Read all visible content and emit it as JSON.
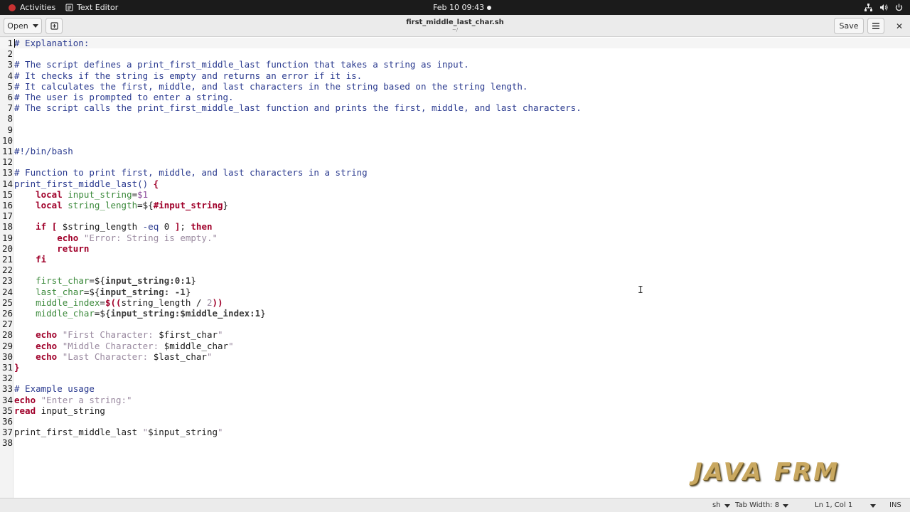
{
  "topbar": {
    "activities": "Activities",
    "app_name": "Text Editor",
    "clock": "Feb 10  09:43"
  },
  "header": {
    "open_label": "Open",
    "save_label": "Save",
    "title": "first_middle_last_char.sh",
    "subtitle": "~/"
  },
  "editor": {
    "lines": [
      [
        [
          "c-comment",
          "# Explanation:"
        ]
      ],
      [],
      [
        [
          "c-comment",
          "# The script defines a print_first_middle_last function that takes a string as input."
        ]
      ],
      [
        [
          "c-comment",
          "# It checks if the string is empty and returns an error if it is."
        ]
      ],
      [
        [
          "c-comment",
          "# It calculates the first, middle, and last characters in the string based on the string length."
        ]
      ],
      [
        [
          "c-comment",
          "# The user is prompted to enter a string."
        ]
      ],
      [
        [
          "c-comment",
          "# The script calls the print_first_middle_last function and prints the first, middle, and last characters."
        ]
      ],
      [],
      [],
      [],
      [
        [
          "c-comment",
          "#!/bin/bash"
        ]
      ],
      [],
      [
        [
          "c-comment",
          "# Function to print first, middle, and last characters in a string"
        ]
      ],
      [
        [
          "c-fn",
          "print_first_middle_last() "
        ],
        [
          "c-brace",
          "{"
        ]
      ],
      [
        [
          "c-plain",
          "    "
        ],
        [
          "c-kw",
          "local"
        ],
        [
          "c-plain",
          " "
        ],
        [
          "c-var",
          "input_string"
        ],
        [
          "c-plain",
          "="
        ],
        [
          "c-num",
          "$1"
        ]
      ],
      [
        [
          "c-plain",
          "    "
        ],
        [
          "c-kw",
          "local"
        ],
        [
          "c-plain",
          " "
        ],
        [
          "c-var",
          "string_length"
        ],
        [
          "c-plain",
          "=${"
        ],
        [
          "c-kw",
          "#input_string"
        ],
        [
          "c-plain",
          "}"
        ]
      ],
      [],
      [
        [
          "c-plain",
          "    "
        ],
        [
          "c-kw",
          "if"
        ],
        [
          "c-plain",
          " "
        ],
        [
          "c-kw",
          "["
        ],
        [
          "c-plain",
          " $string_length "
        ],
        [
          "c-fn",
          "-eq"
        ],
        [
          "c-plain",
          " 0 "
        ],
        [
          "c-kw",
          "]"
        ],
        [
          "c-plain",
          "; "
        ],
        [
          "c-kw",
          "then"
        ]
      ],
      [
        [
          "c-plain",
          "        "
        ],
        [
          "c-kw",
          "echo"
        ],
        [
          "c-plain",
          " "
        ],
        [
          "c-str",
          "\"Error: String is empty.\""
        ]
      ],
      [
        [
          "c-plain",
          "        "
        ],
        [
          "c-kw",
          "return"
        ]
      ],
      [
        [
          "c-plain",
          "    "
        ],
        [
          "c-kw",
          "fi"
        ]
      ],
      [],
      [
        [
          "c-plain",
          "    "
        ],
        [
          "c-var",
          "first_char"
        ],
        [
          "c-plain",
          "=${"
        ],
        [
          "c-sub",
          "input_string:0:1"
        ],
        [
          "c-plain",
          "}"
        ]
      ],
      [
        [
          "c-plain",
          "    "
        ],
        [
          "c-var",
          "last_char"
        ],
        [
          "c-plain",
          "=${"
        ],
        [
          "c-sub",
          "input_string: -1"
        ],
        [
          "c-plain",
          "}"
        ]
      ],
      [
        [
          "c-plain",
          "    "
        ],
        [
          "c-var",
          "middle_index"
        ],
        [
          "c-plain",
          "="
        ],
        [
          "c-kw",
          "$(("
        ],
        [
          "c-plain",
          "string_length / "
        ],
        [
          "c-str",
          "2"
        ],
        [
          "c-kw",
          "))"
        ]
      ],
      [
        [
          "c-plain",
          "    "
        ],
        [
          "c-var",
          "middle_char"
        ],
        [
          "c-plain",
          "=${"
        ],
        [
          "c-sub",
          "input_string:$middle_index:1"
        ],
        [
          "c-plain",
          "}"
        ]
      ],
      [],
      [
        [
          "c-plain",
          "    "
        ],
        [
          "c-kw",
          "echo"
        ],
        [
          "c-plain",
          " "
        ],
        [
          "c-str",
          "\"First Character: "
        ],
        [
          "c-plain",
          "$first_char"
        ],
        [
          "c-str",
          "\""
        ]
      ],
      [
        [
          "c-plain",
          "    "
        ],
        [
          "c-kw",
          "echo"
        ],
        [
          "c-plain",
          " "
        ],
        [
          "c-str",
          "\"Middle Character: "
        ],
        [
          "c-plain",
          "$middle_char"
        ],
        [
          "c-str",
          "\""
        ]
      ],
      [
        [
          "c-plain",
          "    "
        ],
        [
          "c-kw",
          "echo"
        ],
        [
          "c-plain",
          " "
        ],
        [
          "c-str",
          "\"Last Character: "
        ],
        [
          "c-plain",
          "$last_char"
        ],
        [
          "c-str",
          "\""
        ]
      ],
      [
        [
          "c-brace",
          "}"
        ]
      ],
      [],
      [
        [
          "c-comment",
          "# Example usage"
        ]
      ],
      [
        [
          "c-kw",
          "echo"
        ],
        [
          "c-plain",
          " "
        ],
        [
          "c-str",
          "\"Enter a string:\""
        ]
      ],
      [
        [
          "c-kw",
          "read"
        ],
        [
          "c-plain",
          " input_string"
        ]
      ],
      [],
      [
        [
          "c-plain",
          "print_first_middle_last "
        ],
        [
          "c-str",
          "\""
        ],
        [
          "c-plain",
          "$input_string"
        ],
        [
          "c-str",
          "\""
        ]
      ],
      []
    ]
  },
  "watermark": "JAVA FRM",
  "status": {
    "language": "sh",
    "tab_width": "Tab Width: 8",
    "position": "Ln 1, Col 1",
    "mode": "INS"
  },
  "colors": {
    "topbar_bg": "#1b1b1b",
    "headerbar_bg": "#ebebeb",
    "comment": "#2a3a8f",
    "keyword": "#a0002a",
    "variable": "#3c8a3c",
    "string": "#9a8aa0"
  }
}
